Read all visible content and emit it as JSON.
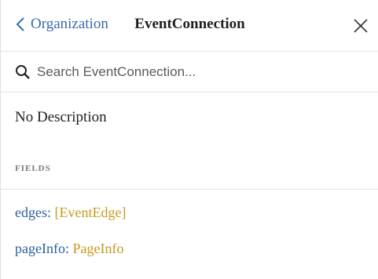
{
  "header": {
    "back_label": "Organization",
    "title": "EventConnection"
  },
  "search": {
    "placeholder": "Search EventConnection..."
  },
  "description": "No Description",
  "fields_section": {
    "label": "FIELDS",
    "items": [
      {
        "name": "edges",
        "separator": ": ",
        "type_prefix": "[",
        "type": "EventEdge",
        "type_suffix": "]"
      },
      {
        "name": "pageInfo",
        "separator": ": ",
        "type_prefix": "",
        "type": "PageInfo",
        "type_suffix": ""
      }
    ]
  },
  "colors": {
    "link": "#3c6aa8",
    "type": "#c89a1a",
    "divider": "#e3e3e3"
  },
  "icons": [
    "chevron-left-icon",
    "close-icon",
    "search-icon"
  ]
}
